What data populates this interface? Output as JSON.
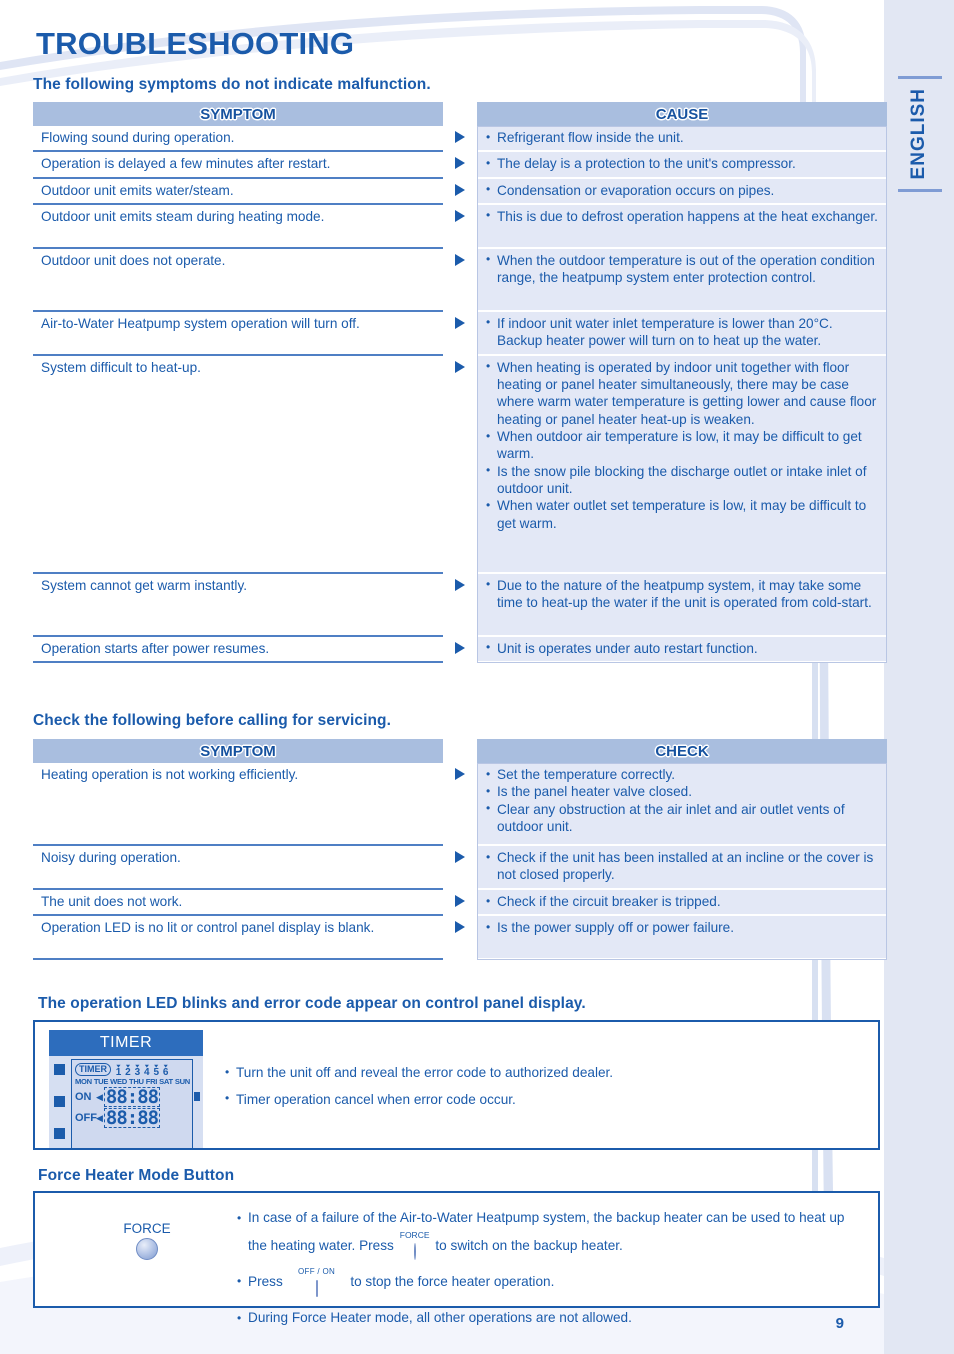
{
  "page": {
    "title": "TROUBLESHOOTING",
    "language_tab": "ENGLISH",
    "page_number": "9",
    "colors": {
      "accent": "#1b5bab",
      "header_bar": "#a9bedf",
      "cause_bg": "#e3e8f6",
      "page_bg": "#e2e7f3"
    }
  },
  "section1": {
    "heading": "The following symptoms do not indicate malfunction.",
    "columns": {
      "symptom": "SYMPTOM",
      "cause": "CAUSE"
    },
    "rows": [
      {
        "symptom": "Flowing sound during operation.",
        "causes": [
          "Refrigerant flow inside the unit."
        ]
      },
      {
        "symptom": "Operation is delayed a few minutes after restart.",
        "causes": [
          "The delay is a protection to the unit's compressor."
        ]
      },
      {
        "symptom": "Outdoor unit emits water/steam.",
        "causes": [
          "Condensation or evaporation occurs on pipes."
        ]
      },
      {
        "symptom": "Outdoor unit emits steam during heating mode.",
        "causes": [
          "This is due to defrost operation happens at the heat exchanger."
        ]
      },
      {
        "symptom": "Outdoor unit does not operate.",
        "causes": [
          "When the outdoor temperature is out of the operation condition range, the heatpump system enter protection control."
        ]
      },
      {
        "symptom": "Air-to-Water Heatpump system operation will turn off.",
        "causes": [
          "If indoor unit water inlet temperature is lower than 20°C. Backup heater power will turn on to heat up the water."
        ]
      },
      {
        "symptom": "System difficult to heat-up.",
        "causes": [
          "When heating is operated by indoor unit together with floor heating or panel heater simultaneously, there may be case where warm water temperature is getting lower and cause floor heating or panel heater heat-up is weaken.",
          "When outdoor air temperature is low, it may be difficult to get warm.",
          "Is the snow pile blocking the discharge outlet or intake inlet of outdoor unit.",
          "When water outlet set temperature is low, it may be difficult to get warm."
        ]
      },
      {
        "symptom": "System cannot get warm instantly.",
        "causes": [
          "Due to the nature of the heatpump system, it may take some time to heat-up the water if the unit is operated from cold-start."
        ]
      },
      {
        "symptom": "Operation starts after power resumes.",
        "causes": [
          "Unit is operates under auto restart function."
        ]
      }
    ]
  },
  "section2": {
    "heading": "Check the following before calling for servicing.",
    "columns": {
      "symptom": "SYMPTOM",
      "check": "CHECK"
    },
    "rows": [
      {
        "symptom": "Heating operation is not working efficiently.",
        "checks": [
          "Set the temperature correctly.",
          "Is the panel heater valve closed.",
          "Clear any obstruction at the air inlet and air outlet vents of outdoor unit."
        ]
      },
      {
        "symptom": "Noisy during operation.",
        "checks": [
          "Check if the unit has been installed at an incline or the cover is not closed properly."
        ]
      },
      {
        "symptom": "The unit does not work.",
        "checks": [
          "Check if the circuit breaker is tripped."
        ]
      },
      {
        "symptom": "Operation LED is no lit or control panel display is blank.",
        "checks": [
          "Is the power supply off or power failure."
        ]
      }
    ]
  },
  "section3": {
    "heading": "The operation LED blinks and error code appear on control panel display.",
    "lcd": {
      "title": "TIMER",
      "timer_label": "TIMER",
      "numbers": [
        "1",
        "2",
        "3",
        "4",
        "5",
        "6"
      ],
      "days": [
        "MON",
        "TUE",
        "WED",
        "THU",
        "FRI",
        "SAT",
        "SUN"
      ],
      "on_label": "ON",
      "off_label": "OFF",
      "on_value": "88:88",
      "off_value": "88:88"
    },
    "bullets": [
      "Turn the unit off and reveal the error code to authorized dealer.",
      "Timer operation cancel when error code occur."
    ]
  },
  "section4": {
    "heading": "Force Heater Mode Button",
    "button_label": "FORCE",
    "bullets": [
      {
        "pre": "In case of a failure of the Air-to-Water Heatpump system, the backup heater can be used to heat up the heating water. Press",
        "icon": "force-button-icon",
        "icon_label": "FORCE",
        "post": "to switch on the backup heater."
      },
      {
        "pre": "Press",
        "icon": "off-on-button-icon",
        "icon_label": "OFF / ON",
        "post": "to stop the force heater operation."
      },
      {
        "pre": "During Force Heater mode, all other operations are not allowed.",
        "icon": null,
        "icon_label": null,
        "post": null
      }
    ]
  }
}
